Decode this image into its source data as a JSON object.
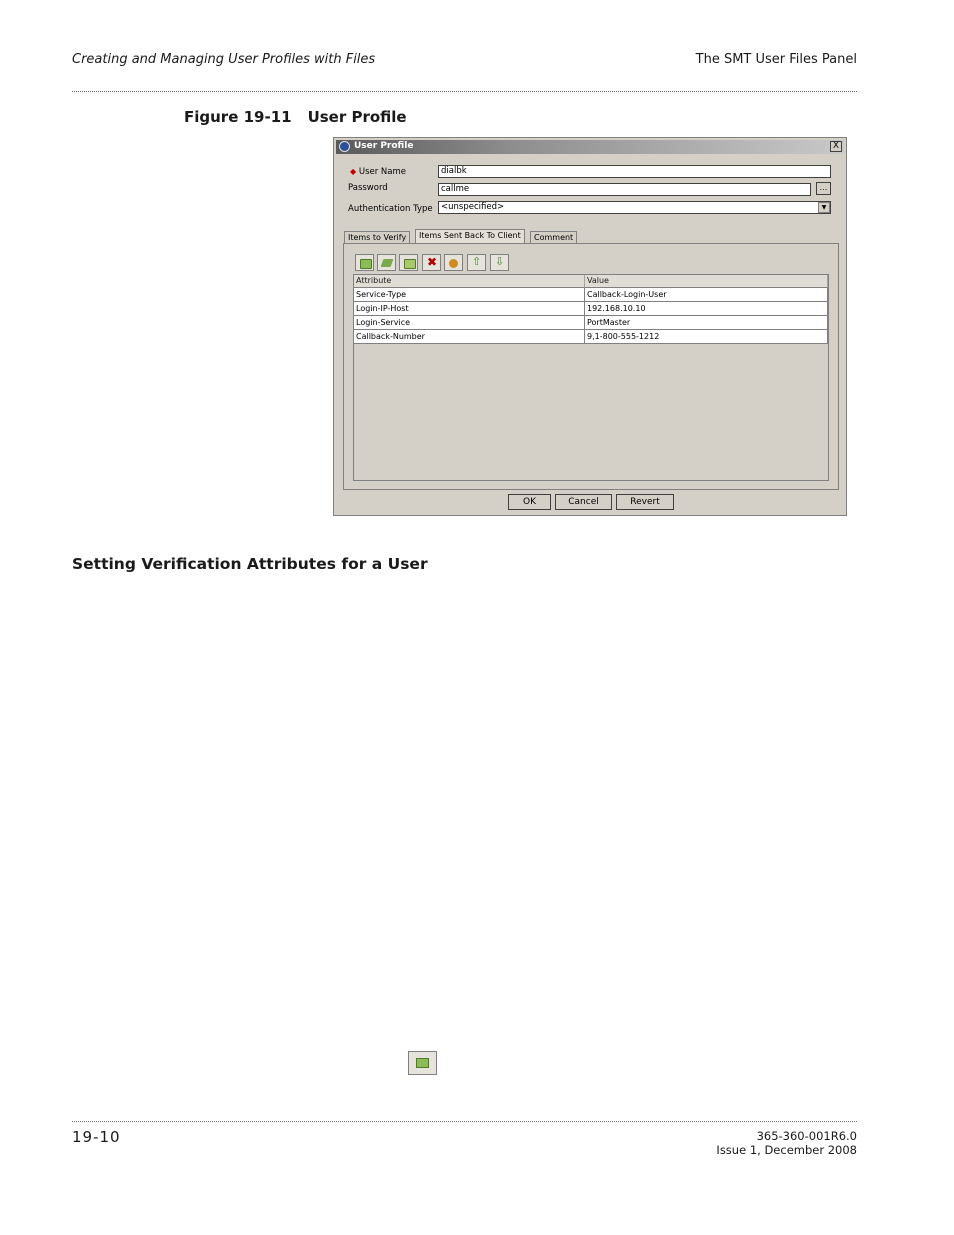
{
  "header": {
    "left": "Creating and Managing User Profiles with Files",
    "right": "The SMT User Files Panel"
  },
  "figure": {
    "number": "Figure 19-11",
    "title": "User Profile"
  },
  "dialog": {
    "title": "User Profile",
    "close_glyph": "X",
    "fields": {
      "user_name_label": "User Name",
      "user_name_value": "dialbk",
      "password_label": "Password",
      "password_value": "callme",
      "password_button": "...",
      "auth_type_label": "Authentication Type",
      "auth_type_value": "<unspecified>"
    },
    "tabs": [
      {
        "label": "Items to Verify",
        "active": false
      },
      {
        "label": "Items Sent Back To Client",
        "active": true
      },
      {
        "label": "Comment",
        "active": false
      }
    ],
    "toolbar_icons": [
      "add-icon",
      "edit-icon",
      "remove-icon",
      "delete-icon",
      "refresh-icon",
      "move-up-icon",
      "move-down-icon"
    ],
    "table": {
      "columns": [
        "Attribute",
        "Value"
      ],
      "rows": [
        [
          "Service-Type",
          "Callback-Login-User"
        ],
        [
          "Login-IP-Host",
          "192.168.10.10"
        ],
        [
          "Login-Service",
          "PortMaster"
        ],
        [
          "Callback-Number",
          "9,1-800-555-1212"
        ]
      ]
    },
    "buttons": {
      "ok": "OK",
      "cancel": "Cancel",
      "revert": "Revert"
    }
  },
  "section_heading": "Setting Verification Attributes for a User",
  "footer": {
    "page": "19-10",
    "doc_number": "365-360-001R6.0",
    "issue": "Issue 1, December 2008"
  },
  "colors": {
    "dialog_bg": "#d4d0c8",
    "required_marker": "#c00000",
    "add_icon_green": "#8cbb57"
  }
}
